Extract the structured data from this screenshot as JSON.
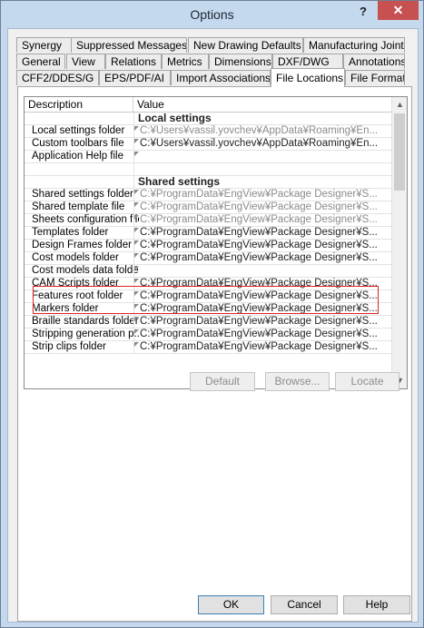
{
  "window": {
    "title": "Options",
    "help_label": "?",
    "close_label": "✕"
  },
  "tabs": {
    "row1": [
      "Synergy",
      "Suppressed Messages",
      "New Drawing Defaults",
      "Manufacturing Joints"
    ],
    "row2": [
      "General",
      "View",
      "Relations",
      "Metrics",
      "Dimensions",
      "DXF/DWG",
      "Annotations"
    ],
    "row3": [
      "CFF2/DDES/G",
      "EPS/PDF/AI",
      "Import Associations",
      "File Locations",
      "File Formats"
    ],
    "active": "File Locations"
  },
  "grid": {
    "headers": [
      "Description",
      "Value"
    ],
    "rows": [
      {
        "desc": "",
        "value": "Local settings",
        "section": true
      },
      {
        "desc": "Local settings folder",
        "value": "C:¥Users¥vassil.yovchev¥AppData¥Roaming¥En...",
        "tone": "grey"
      },
      {
        "desc": "Custom toolbars file",
        "value": "C:¥Users¥vassil.yovchev¥AppData¥Roaming¥En...",
        "tone": "dark"
      },
      {
        "desc": "Application Help file",
        "value": "",
        "tone": "dark"
      },
      {
        "desc": "",
        "value": "",
        "spacer": true
      },
      {
        "desc": "",
        "value": "Shared settings",
        "section": true
      },
      {
        "desc": "Shared settings folder",
        "value": "C:¥ProgramData¥EngView¥Package Designer¥S...",
        "tone": "grey"
      },
      {
        "desc": "Shared template file",
        "value": "C:¥ProgramData¥EngView¥Package Designer¥S...",
        "tone": "grey"
      },
      {
        "desc": "Sheets configuration file",
        "value": "C:¥ProgramData¥EngView¥Package Designer¥S...",
        "tone": "grey"
      },
      {
        "desc": "Templates folder",
        "value": "C:¥ProgramData¥EngView¥Package Designer¥S...",
        "tone": "dark"
      },
      {
        "desc": "Design Frames folder",
        "value": "C:¥ProgramData¥EngView¥Package Designer¥S...",
        "tone": "dark"
      },
      {
        "desc": "Cost models folder",
        "value": "C:¥ProgramData¥EngView¥Package Designer¥S...",
        "tone": "dark"
      },
      {
        "desc": "Cost models data folder",
        "value": "",
        "tone": "dark"
      },
      {
        "desc": "CAM Scripts folder",
        "value": "C:¥ProgramData¥EngView¥Package Designer¥S...",
        "tone": "dark"
      },
      {
        "desc": "Features root folder",
        "value": "C:¥ProgramData¥EngView¥Package Designer¥S...",
        "tone": "dark"
      },
      {
        "desc": "Markers folder",
        "value": "C:¥ProgramData¥EngView¥Package Designer¥S...",
        "tone": "dark"
      },
      {
        "desc": "Braille standards folder",
        "value": "C:¥ProgramData¥EngView¥Package Designer¥S...",
        "tone": "dark"
      },
      {
        "desc": "Stripping generation p...",
        "value": "C:¥ProgramData¥EngView¥Package Designer¥S...",
        "tone": "dark"
      },
      {
        "desc": "Strip clips folder",
        "value": "C:¥ProgramData¥EngView¥Package Designer¥S...",
        "tone": "dark"
      }
    ]
  },
  "actions": {
    "default": "Default",
    "browse": "Browse...",
    "locate": "Locate"
  },
  "footer": {
    "ok": "OK",
    "cancel": "Cancel",
    "help": "Help"
  }
}
